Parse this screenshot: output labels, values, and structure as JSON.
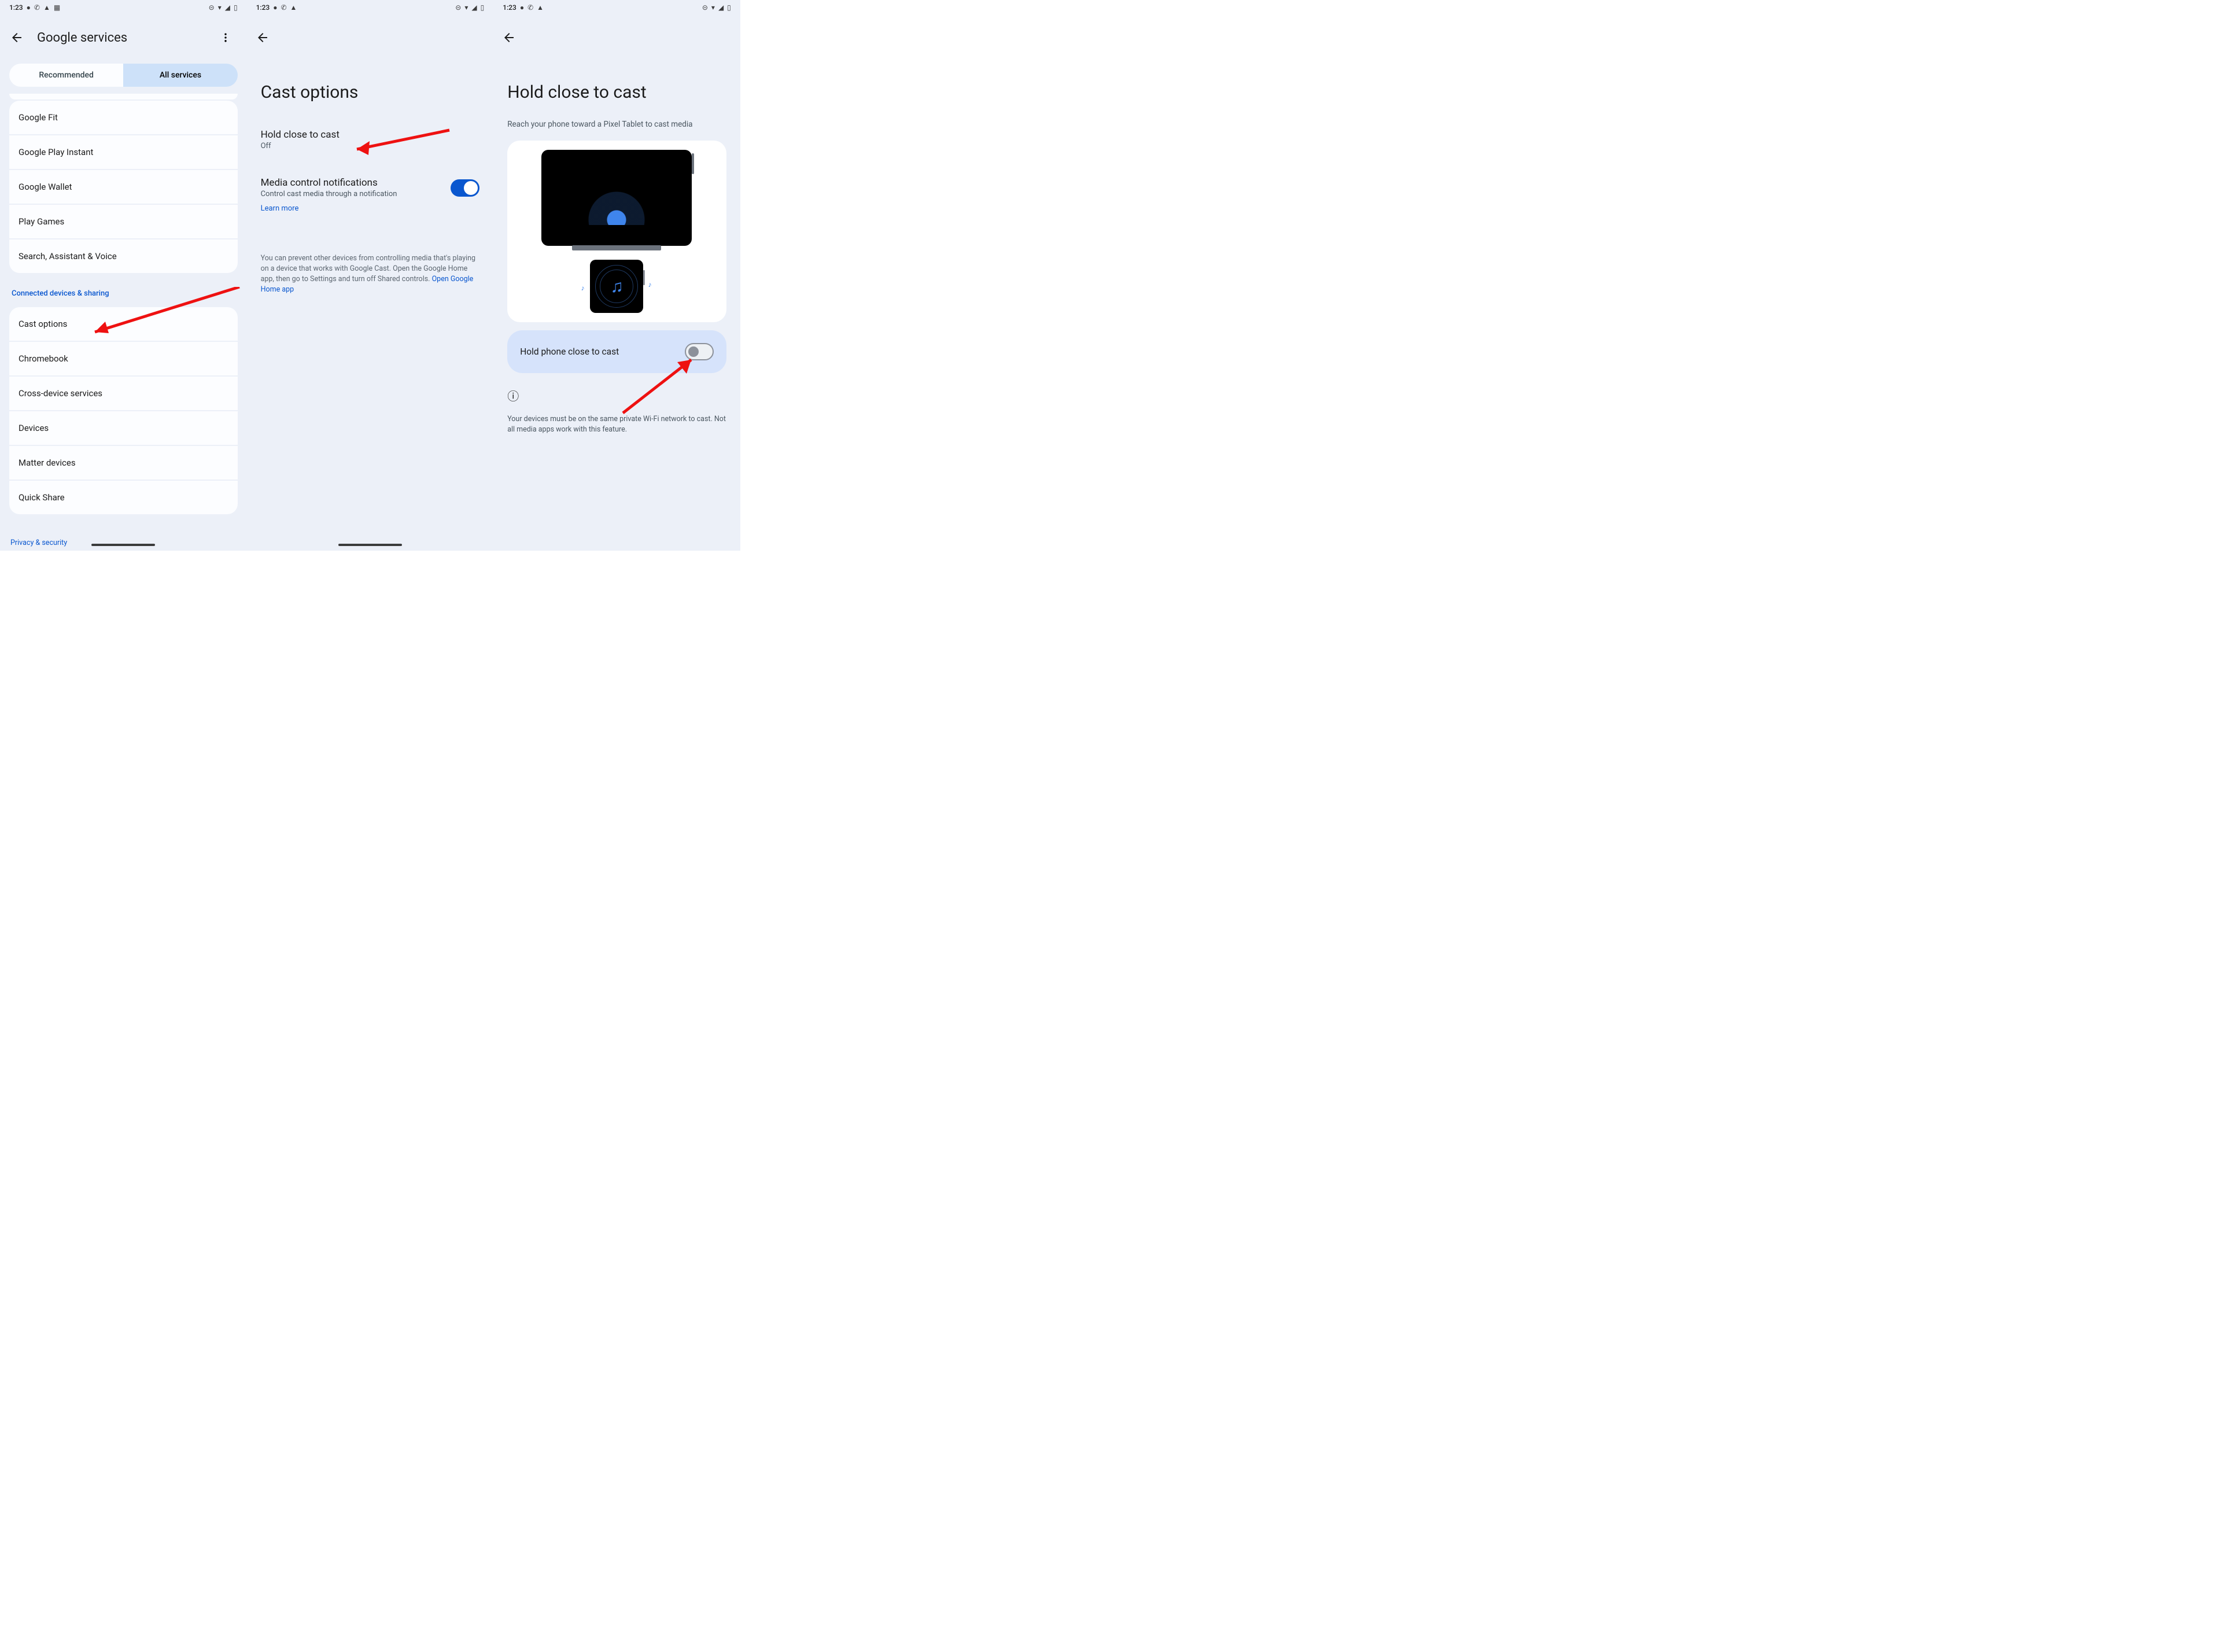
{
  "status": {
    "time": "1:23"
  },
  "col1": {
    "title": "Google services",
    "tabs": {
      "recommended": "Recommended",
      "all": "All services"
    },
    "rows": [
      "Google Fit",
      "Google Play Instant",
      "Google Wallet",
      "Play Games",
      "Search, Assistant & Voice"
    ],
    "subheader": "Connected devices & sharing",
    "rows2": [
      "Cast options",
      "Chromebook",
      "Cross-device services",
      "Devices",
      "Matter devices",
      "Quick Share"
    ],
    "bottom": "Privacy & security"
  },
  "col2": {
    "title": "Cast options",
    "item1": {
      "title": "Hold close to cast",
      "sub": "Off"
    },
    "item2": {
      "title": "Media control notifications",
      "sub": "Control cast media through a notification"
    },
    "learn": "Learn more",
    "info": "You can prevent other devices from controlling media that's playing on a device that works with Google Cast. Open the Google Home app, then go to Settings and turn off Shared controls. ",
    "infolink": "Open Google Home app"
  },
  "col3": {
    "title": "Hold close to cast",
    "sub": "Reach your phone toward a Pixel Tablet to cast media",
    "toggle": "Hold phone close to cast",
    "foot": "Your devices must be on the same private Wi-Fi network to cast. Not all media apps work with this feature."
  }
}
